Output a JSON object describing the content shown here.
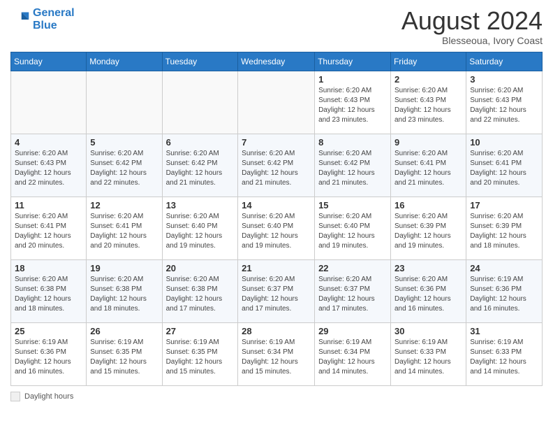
{
  "header": {
    "logo_line1": "General",
    "logo_line2": "Blue",
    "month_year": "August 2024",
    "location": "Blesseoua, Ivory Coast"
  },
  "days_of_week": [
    "Sunday",
    "Monday",
    "Tuesday",
    "Wednesday",
    "Thursday",
    "Friday",
    "Saturday"
  ],
  "weeks": [
    [
      {
        "day": "",
        "info": ""
      },
      {
        "day": "",
        "info": ""
      },
      {
        "day": "",
        "info": ""
      },
      {
        "day": "",
        "info": ""
      },
      {
        "day": "1",
        "info": "Sunrise: 6:20 AM\nSunset: 6:43 PM\nDaylight: 12 hours\nand 23 minutes."
      },
      {
        "day": "2",
        "info": "Sunrise: 6:20 AM\nSunset: 6:43 PM\nDaylight: 12 hours\nand 23 minutes."
      },
      {
        "day": "3",
        "info": "Sunrise: 6:20 AM\nSunset: 6:43 PM\nDaylight: 12 hours\nand 22 minutes."
      }
    ],
    [
      {
        "day": "4",
        "info": "Sunrise: 6:20 AM\nSunset: 6:43 PM\nDaylight: 12 hours\nand 22 minutes."
      },
      {
        "day": "5",
        "info": "Sunrise: 6:20 AM\nSunset: 6:42 PM\nDaylight: 12 hours\nand 22 minutes."
      },
      {
        "day": "6",
        "info": "Sunrise: 6:20 AM\nSunset: 6:42 PM\nDaylight: 12 hours\nand 21 minutes."
      },
      {
        "day": "7",
        "info": "Sunrise: 6:20 AM\nSunset: 6:42 PM\nDaylight: 12 hours\nand 21 minutes."
      },
      {
        "day": "8",
        "info": "Sunrise: 6:20 AM\nSunset: 6:42 PM\nDaylight: 12 hours\nand 21 minutes."
      },
      {
        "day": "9",
        "info": "Sunrise: 6:20 AM\nSunset: 6:41 PM\nDaylight: 12 hours\nand 21 minutes."
      },
      {
        "day": "10",
        "info": "Sunrise: 6:20 AM\nSunset: 6:41 PM\nDaylight: 12 hours\nand 20 minutes."
      }
    ],
    [
      {
        "day": "11",
        "info": "Sunrise: 6:20 AM\nSunset: 6:41 PM\nDaylight: 12 hours\nand 20 minutes."
      },
      {
        "day": "12",
        "info": "Sunrise: 6:20 AM\nSunset: 6:41 PM\nDaylight: 12 hours\nand 20 minutes."
      },
      {
        "day": "13",
        "info": "Sunrise: 6:20 AM\nSunset: 6:40 PM\nDaylight: 12 hours\nand 19 minutes."
      },
      {
        "day": "14",
        "info": "Sunrise: 6:20 AM\nSunset: 6:40 PM\nDaylight: 12 hours\nand 19 minutes."
      },
      {
        "day": "15",
        "info": "Sunrise: 6:20 AM\nSunset: 6:40 PM\nDaylight: 12 hours\nand 19 minutes."
      },
      {
        "day": "16",
        "info": "Sunrise: 6:20 AM\nSunset: 6:39 PM\nDaylight: 12 hours\nand 19 minutes."
      },
      {
        "day": "17",
        "info": "Sunrise: 6:20 AM\nSunset: 6:39 PM\nDaylight: 12 hours\nand 18 minutes."
      }
    ],
    [
      {
        "day": "18",
        "info": "Sunrise: 6:20 AM\nSunset: 6:38 PM\nDaylight: 12 hours\nand 18 minutes."
      },
      {
        "day": "19",
        "info": "Sunrise: 6:20 AM\nSunset: 6:38 PM\nDaylight: 12 hours\nand 18 minutes."
      },
      {
        "day": "20",
        "info": "Sunrise: 6:20 AM\nSunset: 6:38 PM\nDaylight: 12 hours\nand 17 minutes."
      },
      {
        "day": "21",
        "info": "Sunrise: 6:20 AM\nSunset: 6:37 PM\nDaylight: 12 hours\nand 17 minutes."
      },
      {
        "day": "22",
        "info": "Sunrise: 6:20 AM\nSunset: 6:37 PM\nDaylight: 12 hours\nand 17 minutes."
      },
      {
        "day": "23",
        "info": "Sunrise: 6:20 AM\nSunset: 6:36 PM\nDaylight: 12 hours\nand 16 minutes."
      },
      {
        "day": "24",
        "info": "Sunrise: 6:19 AM\nSunset: 6:36 PM\nDaylight: 12 hours\nand 16 minutes."
      }
    ],
    [
      {
        "day": "25",
        "info": "Sunrise: 6:19 AM\nSunset: 6:36 PM\nDaylight: 12 hours\nand 16 minutes."
      },
      {
        "day": "26",
        "info": "Sunrise: 6:19 AM\nSunset: 6:35 PM\nDaylight: 12 hours\nand 15 minutes."
      },
      {
        "day": "27",
        "info": "Sunrise: 6:19 AM\nSunset: 6:35 PM\nDaylight: 12 hours\nand 15 minutes."
      },
      {
        "day": "28",
        "info": "Sunrise: 6:19 AM\nSunset: 6:34 PM\nDaylight: 12 hours\nand 15 minutes."
      },
      {
        "day": "29",
        "info": "Sunrise: 6:19 AM\nSunset: 6:34 PM\nDaylight: 12 hours\nand 14 minutes."
      },
      {
        "day": "30",
        "info": "Sunrise: 6:19 AM\nSunset: 6:33 PM\nDaylight: 12 hours\nand 14 minutes."
      },
      {
        "day": "31",
        "info": "Sunrise: 6:19 AM\nSunset: 6:33 PM\nDaylight: 12 hours\nand 14 minutes."
      }
    ]
  ],
  "footer": {
    "daylight_label": "Daylight hours"
  }
}
